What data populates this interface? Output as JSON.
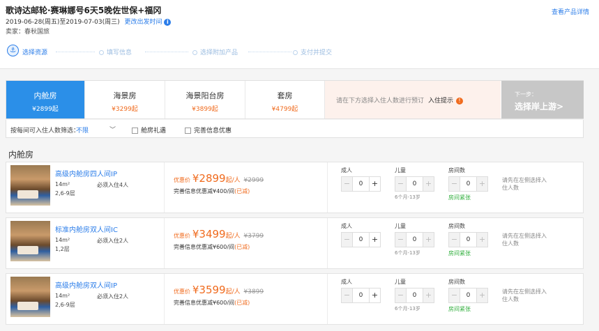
{
  "header": {
    "title": "歌诗达邮轮·赛琳娜号6天5晚佐世保+福冈",
    "dates": "2019-06-28(周五)至2019-07-03(周三)",
    "change_date": "更改出发时间",
    "seller": "卖家：春秋国旅",
    "detail_link": "查看产品详情"
  },
  "steps": [
    {
      "label": "选择资源"
    },
    {
      "label": "填写信息"
    },
    {
      "label": "选择附加产品"
    },
    {
      "label": "支付并提交"
    }
  ],
  "tabs": [
    {
      "name": "内舱房",
      "price": "¥2899起"
    },
    {
      "name": "海景房",
      "price": "¥3299起"
    },
    {
      "name": "海景阳台房",
      "price": "¥3899起"
    },
    {
      "name": "套房",
      "price": "¥4799起"
    }
  ],
  "hint": {
    "text": "请在下方选择入住人数进行预订",
    "label": "入住提示"
  },
  "next": {
    "small": "下一步：",
    "main": "选择岸上游>"
  },
  "filter": {
    "label": "按每间可入住人数筛选：",
    "value": "不限",
    "check1": "舱房礼遇",
    "check2": "完善信息优惠"
  },
  "section_title": "内舱房",
  "labels": {
    "adult": "成人",
    "child": "儿童",
    "rooms": "房间数",
    "child_age": "6个月-13岁",
    "tight": "房间紧张",
    "pick_left": "请先在左侧选择入住人数",
    "price_label": "优惠价",
    "discount_prefix": "完善信息优惠减",
    "reduced": "(已减)"
  },
  "rooms": [
    {
      "name": "高级内舱房四人间IP",
      "area": "14m²",
      "must": "必须入住4人",
      "floors": "2,6-9层",
      "price": "¥2899",
      "unit": "起/人",
      "old": "¥2999",
      "discount": "¥400/间",
      "adult": "0",
      "child": "0",
      "count": "0"
    },
    {
      "name": "标准内舱房双人间IC",
      "area": "14m²",
      "must": "必须入住2人",
      "floors": "1,2层",
      "price": "¥3499",
      "unit": "起/人",
      "old": "¥3799",
      "discount": "¥600/间",
      "adult": "0",
      "child": "0",
      "count": "0"
    },
    {
      "name": "高级内舱房双人间IP",
      "area": "14m²",
      "must": "必须入住2人",
      "floors": "2,6-9层",
      "price": "¥3599",
      "unit": "起/人",
      "old": "¥3899",
      "discount": "¥600/间",
      "adult": "0",
      "child": "0",
      "count": "0"
    }
  ]
}
